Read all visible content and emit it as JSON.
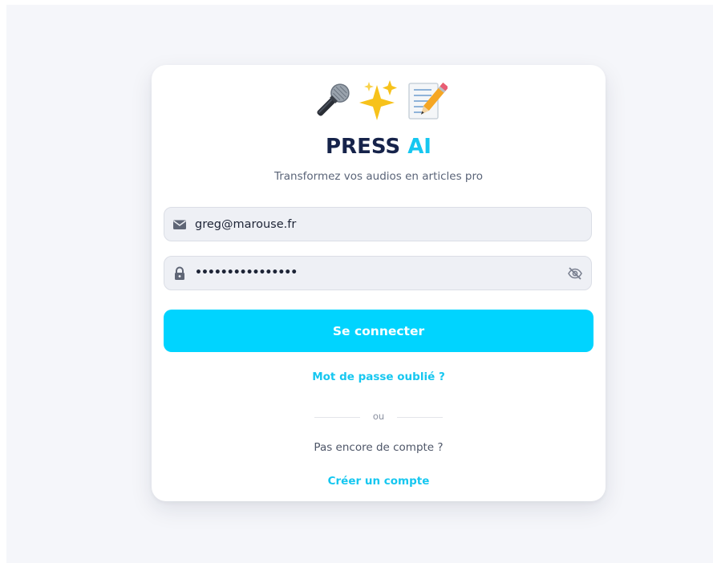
{
  "header": {
    "emojis": [
      "microphone-icon",
      "sparkles-icon",
      "memo-icon"
    ],
    "title_part1": "PRESS",
    "title_part2": "AI",
    "subtitle": "Transformez vos audios en articles pro"
  },
  "form": {
    "email_value": "greg@marouse.fr",
    "password_masked": "••••••••••••••••",
    "email_icon": "envelope-icon",
    "password_icon": "lock-icon",
    "visibility_icon": "eye-slash-icon",
    "submit_label": "Se connecter",
    "forgot_label": "Mot de passe oublié ?"
  },
  "footer": {
    "divider_text": "ou",
    "no_account_text": "Pas encore de compte ?",
    "create_account_label": "Créer un compte"
  },
  "colors": {
    "accent": "#00d4ff",
    "title_dark": "#16234a",
    "link": "#16c7f0",
    "background": "#f5f6fa"
  }
}
